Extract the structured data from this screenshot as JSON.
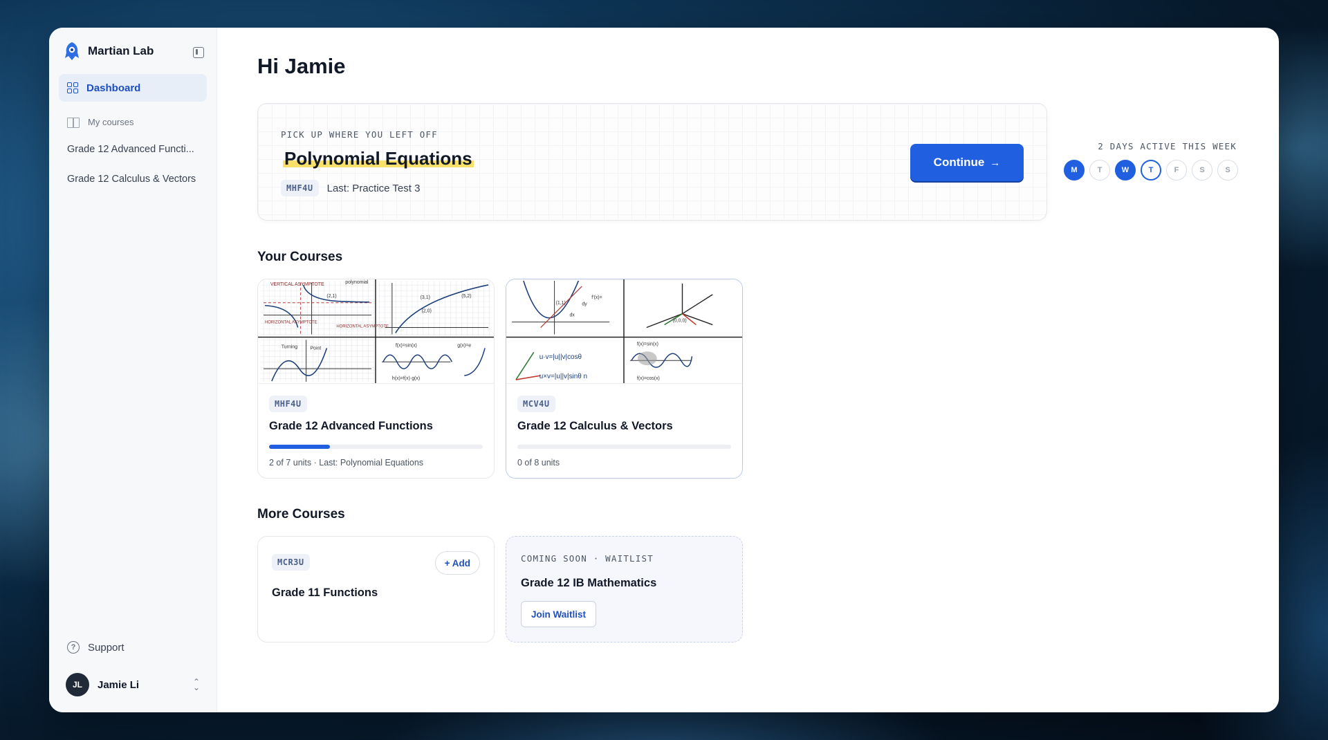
{
  "app": {
    "name": "Martian Lab"
  },
  "sidebar": {
    "dashboard_label": "Dashboard",
    "my_courses_label": "My courses",
    "courses": [
      "Grade 12 Advanced Functi...",
      "Grade 12 Calculus & Vectors"
    ],
    "support_label": "Support",
    "user": {
      "initials": "JL",
      "name": "Jamie Li"
    }
  },
  "main": {
    "greeting": "Hi Jamie",
    "resume": {
      "kicker": "PICK UP WHERE YOU LEFT OFF",
      "title": "Polynomial Equations",
      "code": "MHF4U",
      "last": "Last: Practice Test 3",
      "continue_label": "Continue",
      "continue_icon": "→"
    },
    "streak": {
      "label": "2 DAYS ACTIVE THIS WEEK",
      "days": [
        {
          "letter": "M",
          "state": "active"
        },
        {
          "letter": "T",
          "state": "inactive"
        },
        {
          "letter": "W",
          "state": "active"
        },
        {
          "letter": "T",
          "state": "today"
        },
        {
          "letter": "F",
          "state": "inactive"
        },
        {
          "letter": "S",
          "state": "inactive"
        },
        {
          "letter": "S",
          "state": "inactive"
        }
      ]
    },
    "your_courses_title": "Your Courses",
    "your_courses": [
      {
        "code": "MHF4U",
        "title": "Grade 12 Advanced Functions",
        "progress": 0.286,
        "meta": "2 of 7 units · Last: Polynomial Equations",
        "thumb": {
          "labels": [
            "VERTICAL ASYMPTOTE",
            "polynomial",
            "(2,1)",
            "HORIZONTAL ASYMPTOTE",
            "HORIZONTAL ASYMPTOTE",
            "(3,1)",
            "(5,2)",
            "(2,0)",
            "Turning",
            "Point",
            "f(x)=sin(x)",
            "g(x)=e",
            "h(x)=f(x)·g(x)"
          ]
        }
      },
      {
        "code": "MCV4U",
        "title": "Grade 12 Calculus & Vectors",
        "progress": 0,
        "meta": "0 of 8 units",
        "thumb": {
          "labels": [
            "(1,1)",
            "dy",
            "dx",
            "f'(x)=",
            "(0,0,0)",
            "u·v=|u||v|cosθ",
            "u×v=|u||v|sinθ n",
            "f(x)=sin(x)",
            "f(x)=cos(x)"
          ]
        }
      }
    ],
    "more_courses_title": "More Courses",
    "more_courses": {
      "available": {
        "code": "MCR3U",
        "title": "Grade 11 Functions",
        "add_label": "+ Add"
      },
      "waitlist": {
        "kicker": "COMING SOON · WAITLIST",
        "title": "Grade 12 IB Mathematics",
        "button_label": "Join Waitlist"
      }
    }
  },
  "colors": {
    "accent": "#1f5fe0",
    "highlight": "#f8e06a"
  }
}
